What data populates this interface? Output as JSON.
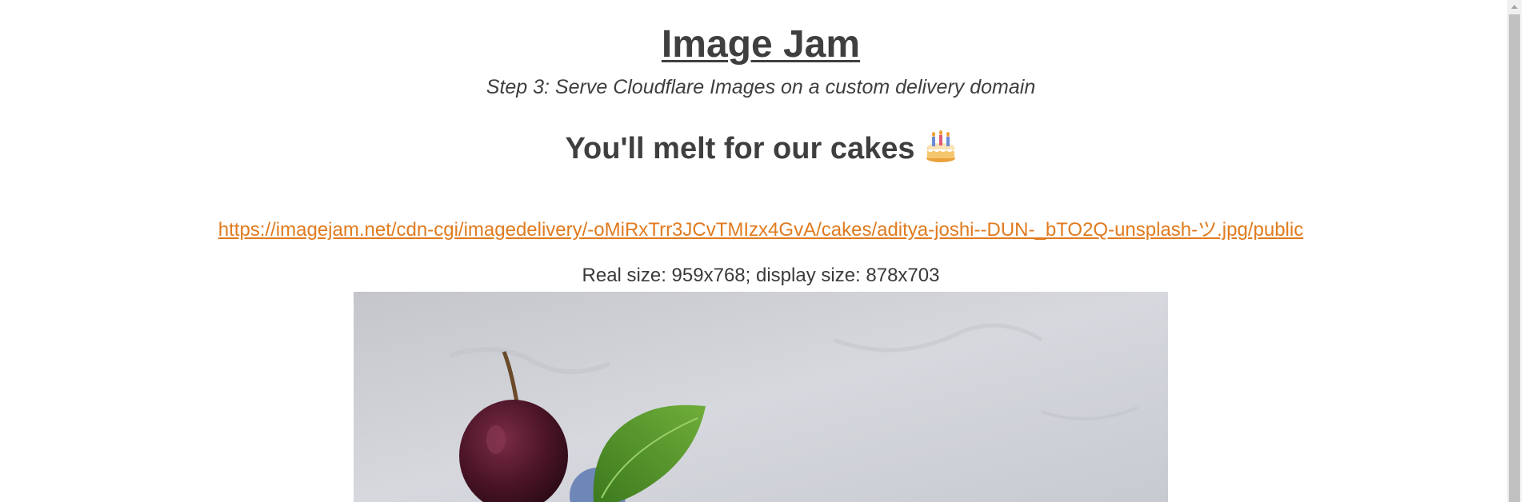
{
  "header": {
    "title": "Image Jam",
    "subtitle": "Step 3: Serve Cloudflare Images on a custom delivery domain"
  },
  "section": {
    "heading": "You'll melt for our cakes",
    "heading_icon": "birthday-cake-icon"
  },
  "image": {
    "url": "https://imagejam.net/cdn-cgi/imagedelivery/-oMiRxTrr3JCvTMIzx4GvA/cakes/aditya-joshi--DUN-_bTO2Q-unsplash-ツ.jpg/public",
    "size_info": "Real size: 959x768; display size: 878x703",
    "subject": "cherry-mint-dessert-photo"
  },
  "colors": {
    "text": "#3f3f3f",
    "link": "#e07b1f",
    "background": "#ffffff"
  }
}
